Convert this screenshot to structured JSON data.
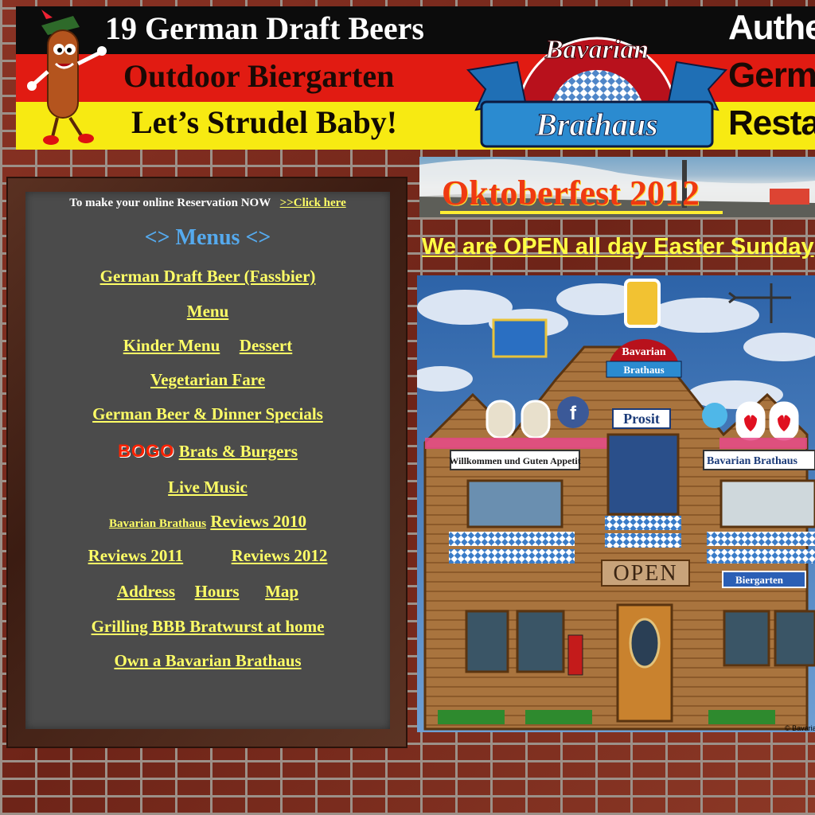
{
  "banner": {
    "line1": "19 German Draft Beers",
    "line2": "Outdoor Biergarten",
    "line3": "Let’s Strudel Baby!",
    "right1": "Authentic",
    "right2": "German",
    "right3": "Restaurant",
    "logo_top": "Bavarian",
    "logo_bottom": "Brathaus"
  },
  "reservation": {
    "text": "To make your online Reservation NOW",
    "link": ">>Click here"
  },
  "menu": {
    "title": "<> Menus  <>",
    "draft_beer": "German Draft Beer (Fassbier)",
    "menu": "Menu",
    "kinder": "Kinder Menu",
    "dessert": "Dessert",
    "vegetarian": "Vegetarian Fare",
    "beer_dinner": "German Beer & Dinner Specials",
    "bogo": "BOGO",
    "brats_burgers": "Brats & Burgers",
    "live_music": "Live Music",
    "reviews_prefix": "Bavarian Brathaus",
    "reviews_2010": "Reviews  2010",
    "reviews_2011": "Reviews 2011",
    "reviews_2012": "Reviews 2012",
    "address": "Address",
    "hours": "Hours",
    "map": "Map",
    "grilling": "Grilling  BBB Bratwurst at home",
    "own": "Own a Bavarian Brathaus"
  },
  "oktoberfest": {
    "title": "Oktoberfest 2012"
  },
  "notice": "We are OPEN all day Easter Sunday",
  "scene": {
    "sign_prosit": "Prosit",
    "sign_willkommen": "Willkommen und Guten Appetit",
    "sign_bavarian": "Bavarian Brathaus",
    "sign_open": "OPEN",
    "sign_biergarten": "Biergarten",
    "copyright": "© Bavarian",
    "logo_top": "Bavarian",
    "logo_bottom": "Brathaus"
  }
}
